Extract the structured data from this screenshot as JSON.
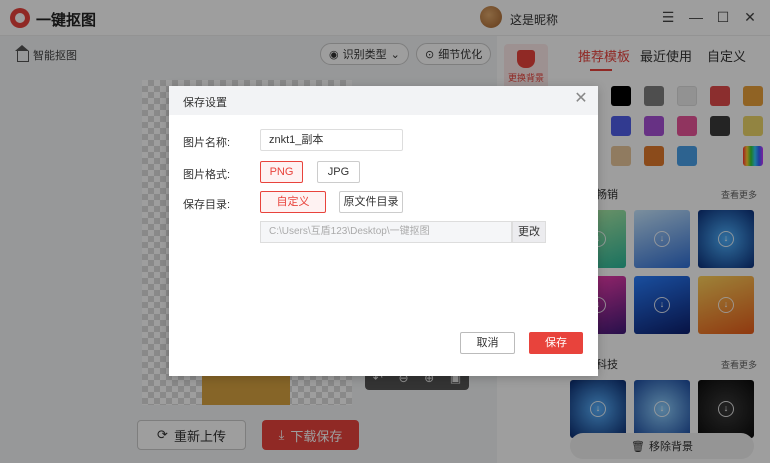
{
  "app": {
    "title": "一键抠图",
    "nickname": "这是昵称"
  },
  "workspace": {
    "breadcrumb": "智能抠图",
    "recognize_type": "识别类型",
    "detail_optimize": "细节优化",
    "reupload": "重新上传",
    "download_save": "下载保存"
  },
  "right_panel": {
    "side_tool_label": "更换背景",
    "tabs": [
      "推荐模板",
      "最近使用",
      "自定义"
    ],
    "active_tab": 0,
    "swatch_colors": [
      "#ffffff",
      "#000000",
      "#7f7f7f",
      "#ececec",
      "#e04b4b",
      "#e9a13a",
      "#2f8fe0",
      "#4f5ee8",
      "#a64fd6",
      "#e85499",
      "#3b3b3b",
      "#ecd56a",
      "#a4c94a",
      "#e8c79c",
      "#e07a2d",
      "#4aa0e8"
    ],
    "section1_title": "畅销",
    "section2_title": "科技",
    "see_more": "查看更多",
    "remove_background": "移除背景"
  },
  "dialog": {
    "title": "保存设置",
    "name_label": "图片名称:",
    "name_value": "znkt1_副本",
    "format_label": "图片格式:",
    "formats": [
      "PNG",
      "JPG"
    ],
    "selected_format": "PNG",
    "dir_label": "保存目录:",
    "dir_options": [
      "自定义",
      "原文件目录"
    ],
    "selected_dir": "自定义",
    "path_value": "C:\\Users\\互盾123\\Desktop\\一键抠图",
    "change_label": "更改",
    "cancel_label": "取消",
    "save_label": "保存"
  }
}
